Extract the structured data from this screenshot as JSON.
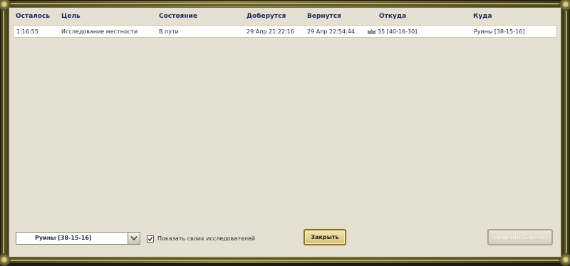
{
  "table": {
    "headers": {
      "remaining": "Осталось",
      "target": "Цель",
      "status": "Состояние",
      "arrive": "Доберутся",
      "return": "Вернутся",
      "from": "Откуда",
      "to": "Куда"
    },
    "rows": [
      {
        "remaining": "1:16:55",
        "target": "Исследование местности",
        "status": "В пути",
        "arrive": "29 Апр 21:22:16",
        "return": "29 Апр 22:54:44",
        "from_icon": "crown-icon",
        "from": "35 [40-16-30]",
        "to": "Руины [38-15-16]"
      }
    ]
  },
  "filter": {
    "selected": "Руины [38-15-16]"
  },
  "show_own": {
    "label": "Показать своих исследователей",
    "checked": true
  },
  "buttons": {
    "close": "Закрыть",
    "save_report": "Сохранить отчет"
  },
  "colors": {
    "header_text": "#1e2a64",
    "panel_bg": "#e6e0d2",
    "frame_gold": "#8e8448"
  }
}
